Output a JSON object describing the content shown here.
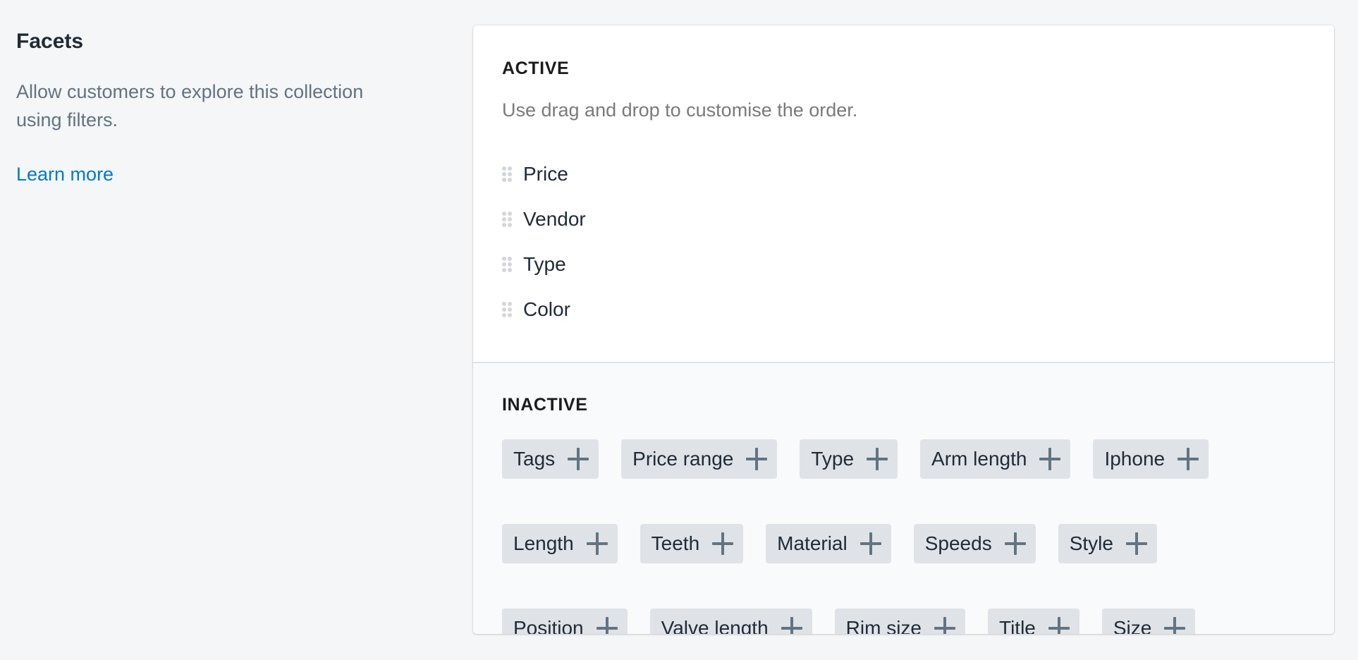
{
  "annotation": {
    "title": "Facets",
    "description": "Allow customers to explore this collection using filters.",
    "learn_more_label": "Learn more",
    "link_color": "#007ace"
  },
  "active": {
    "title": "ACTIVE",
    "help_text": "Use drag and drop to customise the order.",
    "items": [
      {
        "label": "Price"
      },
      {
        "label": "Vendor"
      },
      {
        "label": "Type"
      },
      {
        "label": "Color"
      }
    ]
  },
  "inactive": {
    "title": "INACTIVE",
    "tags": [
      {
        "label": "Tags"
      },
      {
        "label": "Price range"
      },
      {
        "label": "Type"
      },
      {
        "label": "Arm length"
      },
      {
        "label": "Iphone"
      },
      {
        "label": "Length"
      },
      {
        "label": "Teeth"
      },
      {
        "label": "Material"
      },
      {
        "label": "Speeds"
      },
      {
        "label": "Style"
      },
      {
        "label": "Position"
      },
      {
        "label": "Valve length"
      },
      {
        "label": "Rim size"
      },
      {
        "label": "Title"
      },
      {
        "label": "Size"
      }
    ],
    "add_icon": "plus-icon"
  }
}
